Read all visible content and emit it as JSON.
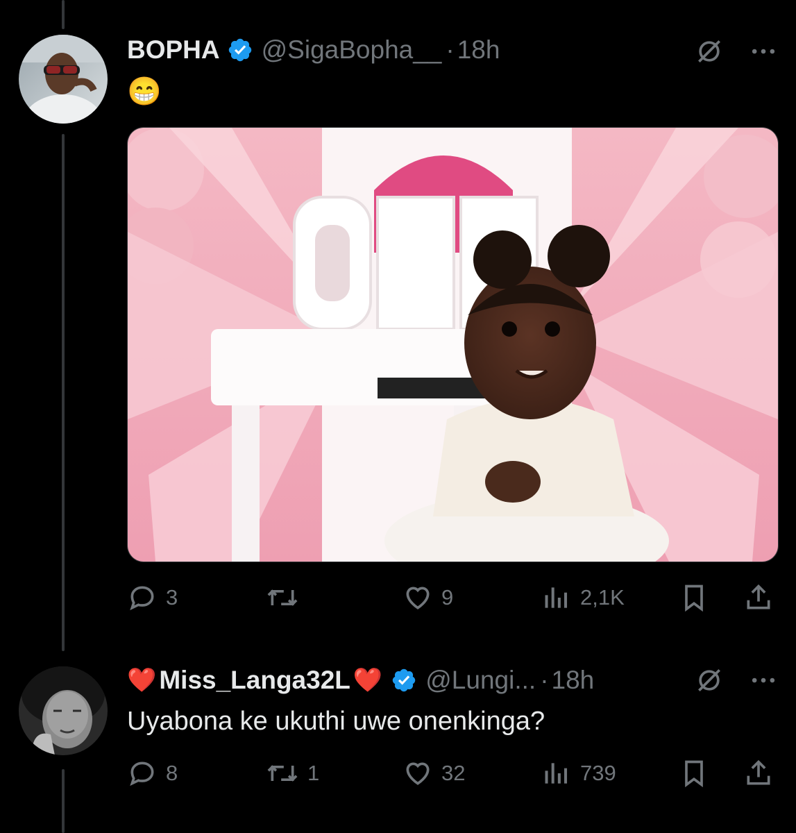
{
  "colors": {
    "background": "#000000",
    "text_primary": "#e7e9ea",
    "text_secondary": "#71767b",
    "verified": "#1d9bf0",
    "heart_emoji": "#e0245e",
    "thread_line": "#333639"
  },
  "tweets": [
    {
      "display_name": "BOPHA",
      "handle": "@SigaBopha__",
      "separator": "·",
      "time": "18h",
      "text": "😁",
      "has_media": true,
      "media_description_icon": "photo",
      "stats": {
        "replies": "3",
        "retweets": "",
        "likes": "9",
        "views": "2,1K"
      }
    },
    {
      "name_prefix_emoji": "❤️",
      "display_name": "Miss_Langa32L",
      "name_suffix_emoji": "❤️",
      "handle": "@Lungi...",
      "separator": "·",
      "time": "18h",
      "text": "Uyabona ke ukuthi uwe onenkinga?",
      "has_media": false,
      "stats": {
        "replies": "8",
        "retweets": "1",
        "likes": "32",
        "views": "739"
      }
    }
  ]
}
